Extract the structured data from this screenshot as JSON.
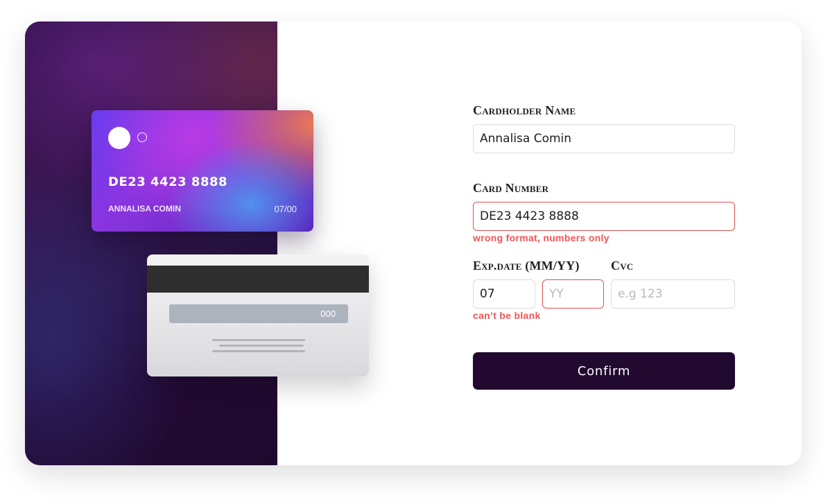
{
  "card_preview": {
    "front": {
      "number": "DE23 4423 8888",
      "name": "ANNALISA COMIN",
      "expiry": "07/00"
    },
    "back": {
      "cvc": "000"
    }
  },
  "form": {
    "cardholder_name": {
      "label": "Cardholder Name",
      "value": "Annalisa Comin"
    },
    "card_number": {
      "label": "Card Number",
      "value": "DE23 4423 8888",
      "error": "wrong format, numbers only"
    },
    "expiry": {
      "label": "Exp.date (MM/YY)",
      "month_value": "07",
      "year_placeholder": "YY",
      "error": "can’t be blank"
    },
    "cvc": {
      "label": "Cvc",
      "placeholder": "e.g 123"
    },
    "confirm_label": "Confirm"
  },
  "colors": {
    "error": "#f05555",
    "button_bg": "#220930",
    "panel_dark": "#230a35"
  }
}
